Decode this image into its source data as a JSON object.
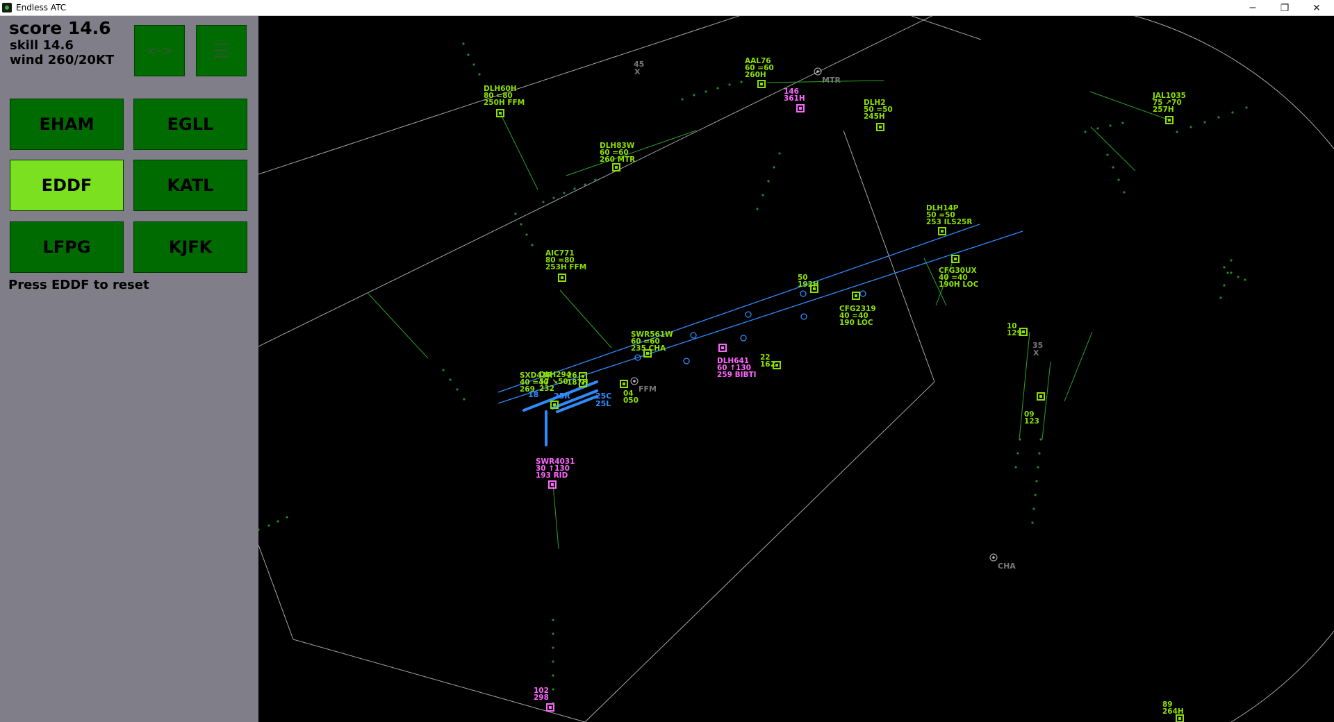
{
  "window": {
    "title": "Endless ATC",
    "minimize": "─",
    "maximize": "❐",
    "close": "✕"
  },
  "sidebar": {
    "score": "score 14.6",
    "skill": "skill 14.6",
    "wind": "wind 260/20KT",
    "swap_label": "<->",
    "menu_label": "☰",
    "airports": [
      "EHAM",
      "EGLL",
      "EDDF",
      "KATL",
      "LFPG",
      "KJFK"
    ],
    "active_airport": "EDDF",
    "reset_hint": "Press EDDF to reset"
  },
  "colors": {
    "accent_green": "#8ee000",
    "button_green": "#006b00",
    "active_green": "#7be020",
    "pink": "#ff66ff",
    "runway_blue": "#2f8cff",
    "sidebar_bg": "#7f7e89"
  },
  "radar": {
    "fixes": [
      "MTR",
      "FFM",
      "CHA"
    ],
    "runways": [
      "25R",
      "25C",
      "25L",
      "18"
    ],
    "markers": [
      {
        "lines": [
          "45",
          "X"
        ]
      },
      {
        "lines": [
          "35",
          "X"
        ]
      }
    ],
    "aircraft": [
      {
        "lines": [
          "DLH60H",
          "80 =80",
          "250H FFM"
        ],
        "color": "green"
      },
      {
        "lines": [
          "AAL76",
          "60 =60",
          "260H"
        ],
        "color": "green"
      },
      {
        "lines": [
          "146",
          "361H"
        ],
        "color": "pink"
      },
      {
        "lines": [
          "DLH2",
          "50 =50",
          "245H"
        ],
        "color": "green"
      },
      {
        "lines": [
          "JAL1035",
          "75 ↗70",
          "257H"
        ],
        "color": "green"
      },
      {
        "lines": [
          "DLH83W",
          "60 =60",
          "260  MTR"
        ],
        "color": "green"
      },
      {
        "lines": [
          "DLH14P",
          "50 =50",
          "253  ILS25R"
        ],
        "color": "green"
      },
      {
        "lines": [
          "CFG30UX",
          "40 =40",
          "190H LOC"
        ],
        "color": "green"
      },
      {
        "lines": [
          "AIC771",
          "80 =80",
          "253H FFM"
        ],
        "color": "green"
      },
      {
        "lines": [
          "50",
          "192H"
        ],
        "color": "green"
      },
      {
        "lines": [
          "CFG2319",
          "40 =40",
          "190  LOC"
        ],
        "color": "green"
      },
      {
        "lines": [
          "SWR561W",
          "60 =60",
          "235  CHA"
        ],
        "color": "green"
      },
      {
        "lines": [
          "DLH641",
          "60 ↑130",
          "259  BIBTI"
        ],
        "color": "pink"
      },
      {
        "lines": [
          "22",
          "162"
        ],
        "color": "green"
      },
      {
        "lines": [
          "26",
          "187H"
        ],
        "color": "green"
      },
      {
        "lines": [
          "10",
          "129"
        ],
        "color": "green"
      },
      {
        "lines": [
          "SXD43R",
          "40 =40",
          "269"
        ],
        "color": "green"
      },
      {
        "lines": [
          "04",
          "050"
        ],
        "color": "green"
      },
      {
        "lines": [
          "09",
          "123"
        ],
        "color": "green"
      },
      {
        "lines": [
          "DLH294",
          "57 ↘50",
          "232"
        ],
        "color": "green"
      },
      {
        "lines": [
          "SWR4031",
          "30 ↑130",
          "193  RID"
        ],
        "color": "pink"
      },
      {
        "lines": [
          "102",
          "298"
        ],
        "color": "pink"
      },
      {
        "lines": [
          "89",
          "264H"
        ],
        "color": "green"
      }
    ]
  }
}
